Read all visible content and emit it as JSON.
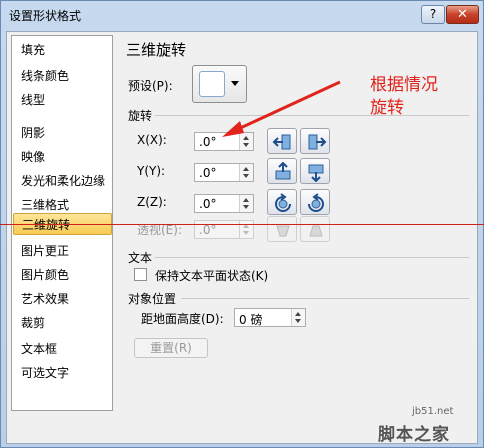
{
  "window": {
    "title": "设置形状格式",
    "help_label": "?",
    "close_label": "✕"
  },
  "sidebar": {
    "items": [
      {
        "label": "填充"
      },
      {
        "label": "线条颜色"
      },
      {
        "label": "线型"
      },
      {
        "label": "阴影"
      },
      {
        "label": "映像"
      },
      {
        "label": "发光和柔化边缘"
      },
      {
        "label": "三维格式"
      },
      {
        "label": "三维旋转",
        "selected": true
      },
      {
        "label": "图片更正"
      },
      {
        "label": "图片颜色"
      },
      {
        "label": "艺术效果"
      },
      {
        "label": "裁剪"
      },
      {
        "label": "文本框"
      },
      {
        "label": "可选文字"
      }
    ]
  },
  "main": {
    "section_title": "三维旋转",
    "preset_label": "预设(P):",
    "rotation_group": "旋转",
    "x_label": "X(X):",
    "x_value": ".0°",
    "y_label": "Y(Y):",
    "y_value": ".0°",
    "z_label": "Z(Z):",
    "z_value": ".0°",
    "perspective_label": "透视(E):",
    "perspective_value": ".0°",
    "text_group": "文本",
    "keep_flat_label": "保持文本平面状态(K)",
    "keep_flat_checked": false,
    "object_position_group": "对象位置",
    "distance_label": "距地面高度(D):",
    "distance_value": "0 磅",
    "reset_label": "重置(R)"
  },
  "annotation": {
    "text_line1": "根据情况",
    "text_line2": "旋转",
    "color": "#e0241b"
  },
  "watermark": {
    "url": "jb51.net",
    "name": "脚本之家"
  },
  "icons": {
    "x_left": "rotate-left-icon",
    "x_right": "rotate-right-icon",
    "y_up": "rotate-up-icon",
    "y_down": "rotate-down-icon",
    "z_ccw": "counterclockwise-icon",
    "z_cw": "clockwise-icon",
    "persp_narrow": "narrow-perspective-icon",
    "persp_widen": "widen-perspective-icon"
  }
}
